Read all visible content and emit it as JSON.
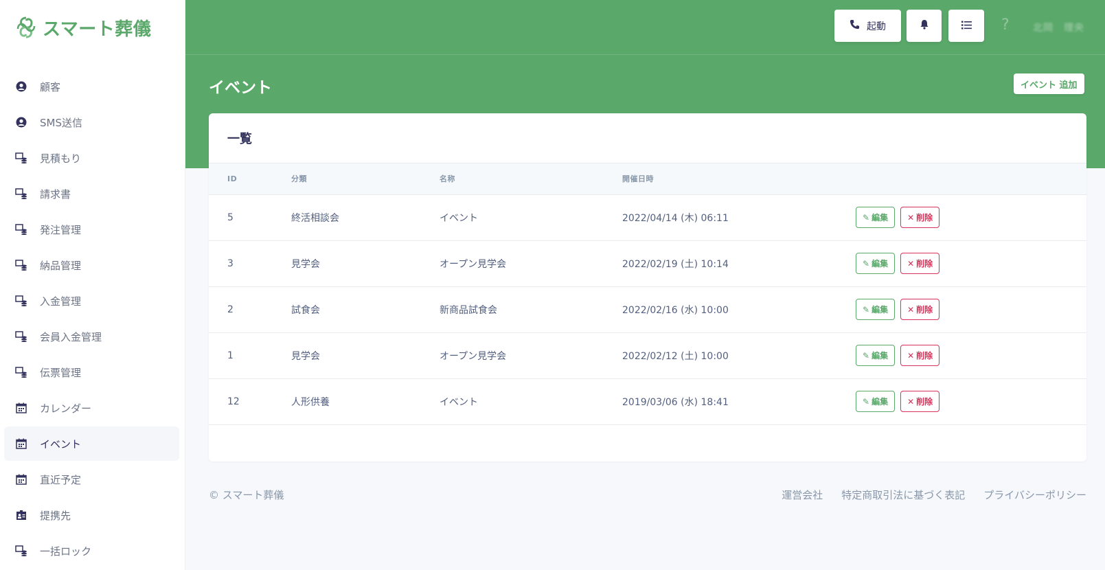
{
  "brand": {
    "name": "スマート葬儀",
    "color": "#5aa86a",
    "logo_icon": "brand-knot-logo"
  },
  "sidebar": {
    "items": [
      {
        "label": "顧客",
        "icon": "user-circle-icon"
      },
      {
        "label": "SMS送信",
        "icon": "user-circle-icon"
      },
      {
        "label": "見積もり",
        "icon": "stack-coins-icon"
      },
      {
        "label": "請求書",
        "icon": "stack-coins-icon"
      },
      {
        "label": "発注管理",
        "icon": "stack-coins-icon"
      },
      {
        "label": "納品管理",
        "icon": "stack-coins-icon"
      },
      {
        "label": "入金管理",
        "icon": "stack-coins-icon"
      },
      {
        "label": "会員入金管理",
        "icon": "stack-coins-icon"
      },
      {
        "label": "伝票管理",
        "icon": "stack-coins-icon"
      },
      {
        "label": "カレンダー",
        "icon": "calendar-icon"
      },
      {
        "label": "イベント",
        "icon": "calendar-icon",
        "active": true
      },
      {
        "label": "直近予定",
        "icon": "calendar-icon"
      },
      {
        "label": "提携先",
        "icon": "id-badge-icon"
      },
      {
        "label": "一括ロック",
        "icon": "stack-coins-icon"
      }
    ]
  },
  "topbar": {
    "launch_label": "起動",
    "help_label": "?",
    "user_name": "北岡　理央"
  },
  "page": {
    "title": "イベント",
    "add_button": "イベント 追加"
  },
  "card": {
    "title": "一覧",
    "columns": [
      "ID",
      "分類",
      "名称",
      "開催日時",
      ""
    ],
    "rows": [
      {
        "id": "5",
        "category": "終活相談会",
        "name": "イベント",
        "datetime": "2022/04/14 (木) 06:11"
      },
      {
        "id": "3",
        "category": "見学会",
        "name": "オープン見学会",
        "datetime": "2022/02/19 (土) 10:14"
      },
      {
        "id": "2",
        "category": "試食会",
        "name": "新商品試食会",
        "datetime": "2022/02/16 (水) 10:00"
      },
      {
        "id": "1",
        "category": "見学会",
        "name": "オープン見学会",
        "datetime": "2022/02/12 (土) 10:00"
      },
      {
        "id": "12",
        "category": "人形供養",
        "name": "イベント",
        "datetime": "2019/03/06 (水) 18:41"
      }
    ],
    "edit_label": "編集",
    "delete_label": "削除"
  },
  "footer": {
    "copyright": "© スマート葬儀",
    "links": [
      "運営会社",
      "特定商取引法に基づく表記",
      "プライバシーポリシー"
    ]
  },
  "colors": {
    "accent": "#5aa86a",
    "danger": "#d9325a"
  }
}
